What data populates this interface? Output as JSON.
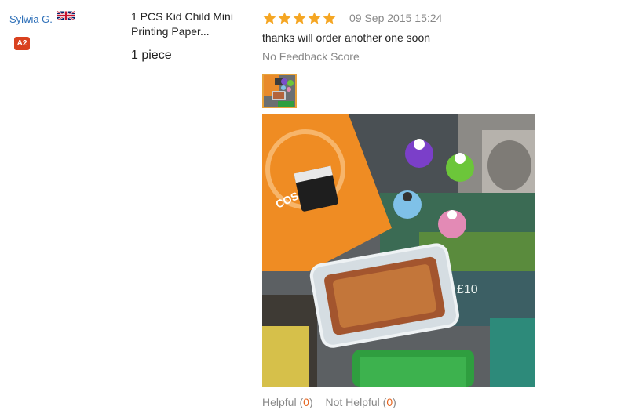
{
  "buyer": {
    "name": "Sylwia G.",
    "country_flag": "uk-flag-icon",
    "level_badge": "A2",
    "badge_color": "#d9411f"
  },
  "product": {
    "name_line1": "1 PCS Kid Child Mini",
    "name_line2": "Printing Paper...",
    "quantity": "1 piece"
  },
  "review": {
    "rating": 5,
    "rating_max": 5,
    "star_color": "#f5a623",
    "date": "09 Sep 2015 15:24",
    "comment": "thanks will order another one soon",
    "feedback_score": "No Feedback Score"
  },
  "photo": {
    "icon": "review-photo-image",
    "bag_text": "COSATTO",
    "label_text": "£10"
  },
  "helpful": {
    "helpful_label": "Helpful (",
    "helpful_count": "0",
    "not_helpful_label": "Not Helpful (",
    "not_helpful_count": "0",
    "close_paren": ")",
    "count_color": "#e5641e"
  }
}
